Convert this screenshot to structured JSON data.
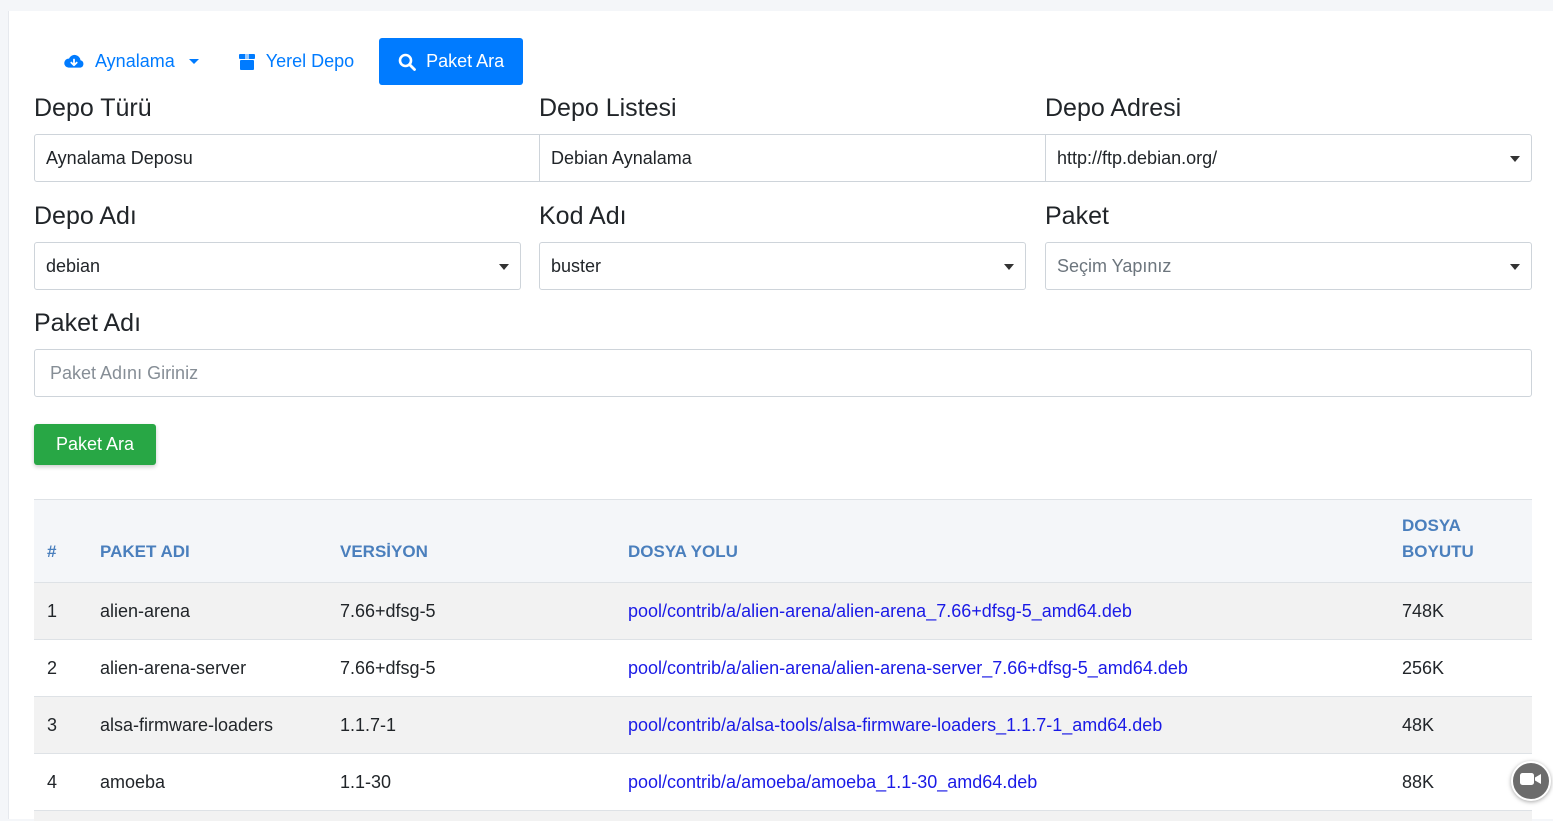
{
  "tabs": [
    {
      "label": "Aynalama",
      "icon": "cloud-download-icon",
      "dropdown": true,
      "active": false
    },
    {
      "label": "Yerel Depo",
      "icon": "box-icon",
      "active": false
    },
    {
      "label": "Paket Ara",
      "icon": "search-icon",
      "active": true
    }
  ],
  "form": {
    "depo_turu": {
      "label": "Depo Türü",
      "value": "Aynalama Deposu"
    },
    "depo_listesi": {
      "label": "Depo Listesi",
      "value": "Debian Aynalama"
    },
    "depo_adresi": {
      "label": "Depo Adresi",
      "value": "http://ftp.debian.org/"
    },
    "depo_adi": {
      "label": "Depo Adı",
      "value": "debian"
    },
    "kod_adi": {
      "label": "Kod Adı",
      "value": "buster"
    },
    "paket": {
      "label": "Paket",
      "value": "Seçim Yapınız"
    },
    "paket_adi": {
      "label": "Paket Adı",
      "placeholder": "Paket Adını Giriniz",
      "value": ""
    },
    "search_button": "Paket Ara"
  },
  "table": {
    "headers": {
      "num": "#",
      "name": "PAKET ADI",
      "version": "VERSİYON",
      "path": "DOSYA YOLU",
      "size_line1": "DOSYA",
      "size_line2": "BOYUTU"
    },
    "rows": [
      {
        "num": "1",
        "name": "alien-arena",
        "version": "7.66+dfsg-5",
        "path": "pool/contrib/a/alien-arena/alien-arena_7.66+dfsg-5_amd64.deb",
        "size": "748K"
      },
      {
        "num": "2",
        "name": "alien-arena-server",
        "version": "7.66+dfsg-5",
        "path": "pool/contrib/a/alien-arena/alien-arena-server_7.66+dfsg-5_amd64.deb",
        "size": "256K"
      },
      {
        "num": "3",
        "name": "alsa-firmware-loaders",
        "version": "1.1.7-1",
        "path": "pool/contrib/a/alsa-tools/alsa-firmware-loaders_1.1.7-1_amd64.deb",
        "size": "48K"
      },
      {
        "num": "4",
        "name": "amoeba",
        "version": "1.1-30",
        "path": "pool/contrib/a/amoeba/amoeba_1.1-30_amd64.deb",
        "size": "88K"
      }
    ]
  },
  "colors": {
    "primary": "#007bff",
    "success": "#28a745",
    "header_text": "#4a7fbd",
    "link": "#1a1ae6"
  }
}
